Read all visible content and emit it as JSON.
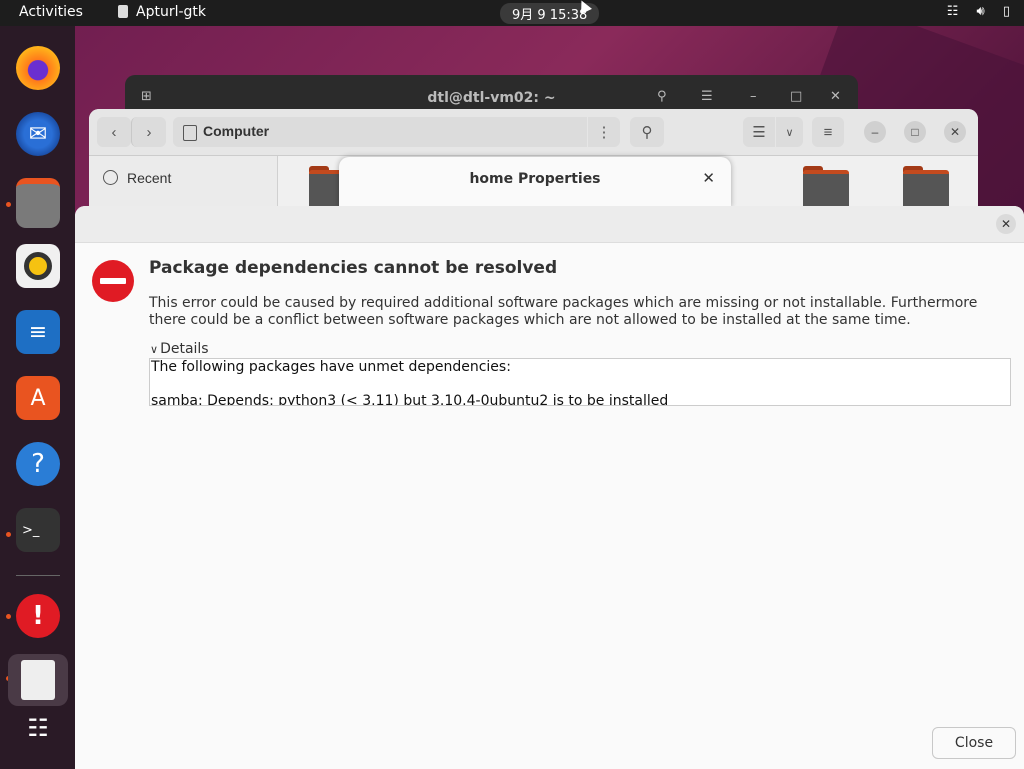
{
  "topbar": {
    "activities": "Activities",
    "app_name": "Apturl-gtk",
    "clock": "9月 9  15:38"
  },
  "dock": {
    "items": [
      "firefox-icon",
      "thunderbird-icon",
      "files-icon",
      "rhythmbox-icon",
      "writer-icon",
      "app-center-icon",
      "help-icon",
      "terminal-icon",
      "error-report-icon",
      "archive-icon",
      "show-apps-icon"
    ]
  },
  "terminal_window": {
    "title": "dtl@dtl-vm02: ~"
  },
  "files_window": {
    "path": "Computer",
    "sidebar": {
      "recent": "Recent"
    }
  },
  "properties_dialog": {
    "title": "home Properties"
  },
  "dialog": {
    "headline": "Package dependencies cannot be resolved",
    "description": "This error could be caused by required additional software packages which are missing or not installable. Furthermore there could be a conflict between software packages which are not allowed to be installed at the same time.",
    "details_label": "Details",
    "details_lines": [
      "The following packages have unmet dependencies:",
      "",
      "samba: Depends: python3 (< 3.11) but 3.10.4-0ubuntu2 is to be installed"
    ],
    "close_label": "Close"
  },
  "colors": {
    "error": "#e01b24",
    "accent": "#e95420",
    "topbar": "#1d1d1d"
  }
}
